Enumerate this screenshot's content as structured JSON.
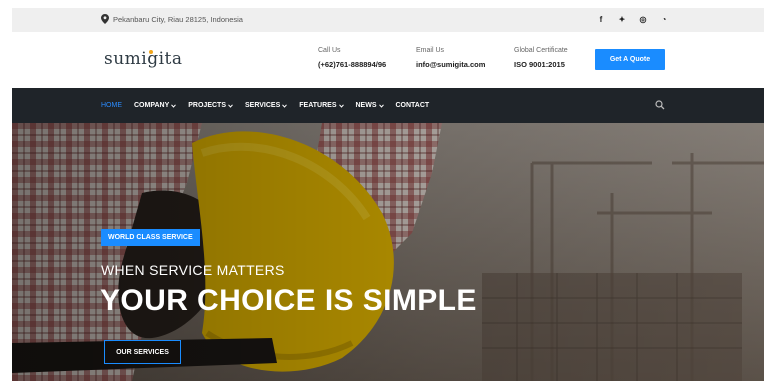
{
  "topbar": {
    "location": "Pekanbaru City, Riau 28125, Indonesia",
    "socials": [
      {
        "icon": "facebook-icon",
        "glyph": "f"
      },
      {
        "icon": "twitter-icon",
        "glyph": "✦"
      },
      {
        "icon": "instagram-icon",
        "glyph": "◎"
      },
      {
        "icon": "github-icon",
        "glyph": "◔"
      }
    ]
  },
  "header": {
    "logo": "sumigita",
    "call_label": "Call Us",
    "call_value": "(+62)761-888894/96",
    "email_label": "Email Us",
    "email_value": "info@sumigita.com",
    "cert_label": "Global Certificate",
    "cert_value": "ISO 9001:2015",
    "quote_button": "Get A Quote"
  },
  "nav": {
    "items": [
      {
        "label": "HOME",
        "active": true,
        "dropdown": false
      },
      {
        "label": "COMPANY",
        "active": false,
        "dropdown": true
      },
      {
        "label": "PROJECTS",
        "active": false,
        "dropdown": true
      },
      {
        "label": "SERVICES",
        "active": false,
        "dropdown": true
      },
      {
        "label": "FEATURES",
        "active": false,
        "dropdown": true
      },
      {
        "label": "NEWS",
        "active": false,
        "dropdown": true
      },
      {
        "label": "CONTACT",
        "active": false,
        "dropdown": false
      }
    ]
  },
  "hero": {
    "badge": "WORLD CLASS SERVICE",
    "kicker": "WHEN SERVICE MATTERS",
    "headline": "YOUR CHOICE IS SIMPLE",
    "button": "OUR SERVICES"
  },
  "colors": {
    "accent": "#1a8cff",
    "nav_bg": "#1f2429",
    "topbar_bg": "#efefef"
  }
}
